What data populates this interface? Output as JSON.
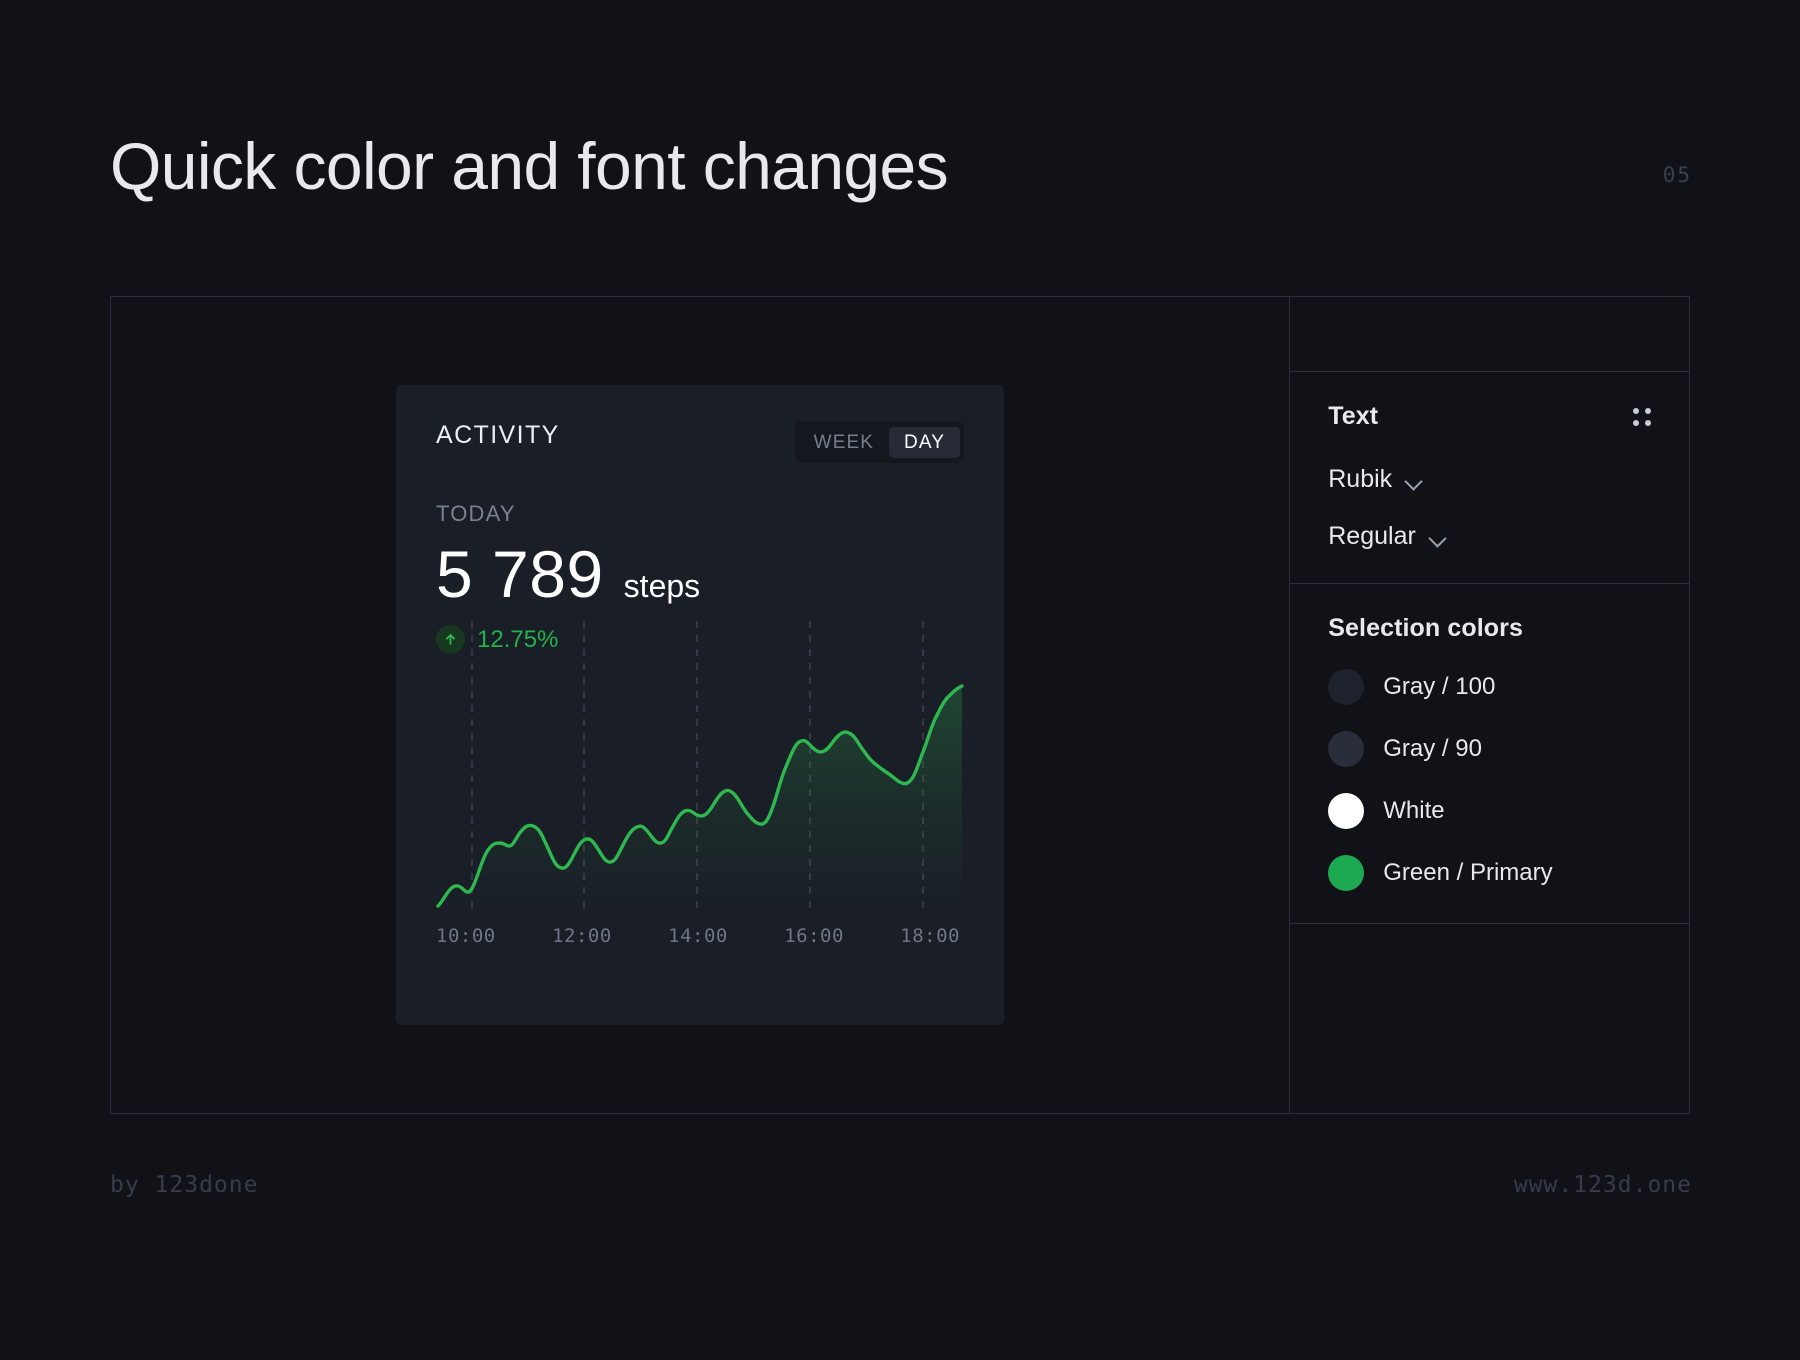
{
  "slide": {
    "title": "Quick color and font changes",
    "page_number": "05",
    "background_color": "#101218",
    "frame_border_color": "#2B3040"
  },
  "activity_card": {
    "title": "ACTIVITY",
    "toggle": {
      "options": [
        "WEEK",
        "DAY"
      ],
      "selected": "DAY",
      "week_label": "WEEK",
      "day_label": "DAY"
    },
    "period_label": "TODAY",
    "metric_value": "5 789",
    "metric_unit": "steps",
    "delta_icon": "arrow-up-icon",
    "delta_value": "12.75%",
    "delta_color": "#22B24C",
    "card_background": "#1A1E27"
  },
  "chart_data": {
    "type": "area",
    "title": "ACTIVITY",
    "xlabel": "",
    "ylabel": "steps",
    "line_color": "#2EB84F",
    "fill_gradient_top": "#2EB84F",
    "grid": true,
    "grid_style": "dashed-vertical",
    "legend_position": "none",
    "tick_labels": [
      "10:00",
      "12:00",
      "14:00",
      "16:00",
      "18:00"
    ],
    "x": [
      9.0,
      9.2,
      9.4,
      9.6,
      9.8,
      10.0,
      10.2,
      10.4,
      10.6,
      10.8,
      11.0,
      11.2,
      11.4,
      11.6,
      11.8,
      12.0,
      12.2,
      12.4,
      12.6,
      12.8,
      13.0,
      13.2,
      13.4,
      13.6,
      13.8,
      14.0,
      14.2,
      14.4,
      14.6,
      14.8,
      15.0,
      15.2,
      15.4,
      15.6,
      15.8,
      16.0,
      16.2,
      16.4,
      16.6,
      16.8,
      17.0,
      17.2,
      17.4,
      17.6,
      17.8,
      18.0,
      18.2,
      18.4,
      18.6
    ],
    "values": [
      180,
      340,
      520,
      480,
      560,
      1150,
      1420,
      1380,
      1520,
      2100,
      2240,
      2000,
      1560,
      1340,
      1620,
      2080,
      2180,
      1760,
      1680,
      2060,
      2420,
      2360,
      2720,
      2640,
      2900,
      3100,
      2860,
      3260,
      3640,
      3720,
      3420,
      2960,
      2880,
      3360,
      4320,
      4580,
      4520,
      4960,
      5180,
      5080,
      4700,
      4380,
      4460,
      4280,
      3560,
      3420,
      4320,
      5320,
      5789
    ],
    "ylim": [
      0,
      6000
    ],
    "xlim": [
      9.0,
      18.6
    ]
  },
  "side_panel": {
    "text_section": {
      "title": "Text",
      "menu_icon": "grid-dots-icon",
      "font_family": "Rubik",
      "font_weight": "Regular",
      "chevron_icon": "chevron-down-icon"
    },
    "colors_section": {
      "title": "Selection colors",
      "swatches": [
        {
          "label": "Gray / 100",
          "color": "#1E222C"
        },
        {
          "label": "Gray / 90",
          "color": "#2A2E3A"
        },
        {
          "label": "White",
          "color": "#FFFFFF"
        },
        {
          "label": "Green / Primary",
          "color": "#1DA94F"
        }
      ]
    }
  },
  "footer": {
    "left": "by  123done",
    "right": "www.123d.one"
  }
}
